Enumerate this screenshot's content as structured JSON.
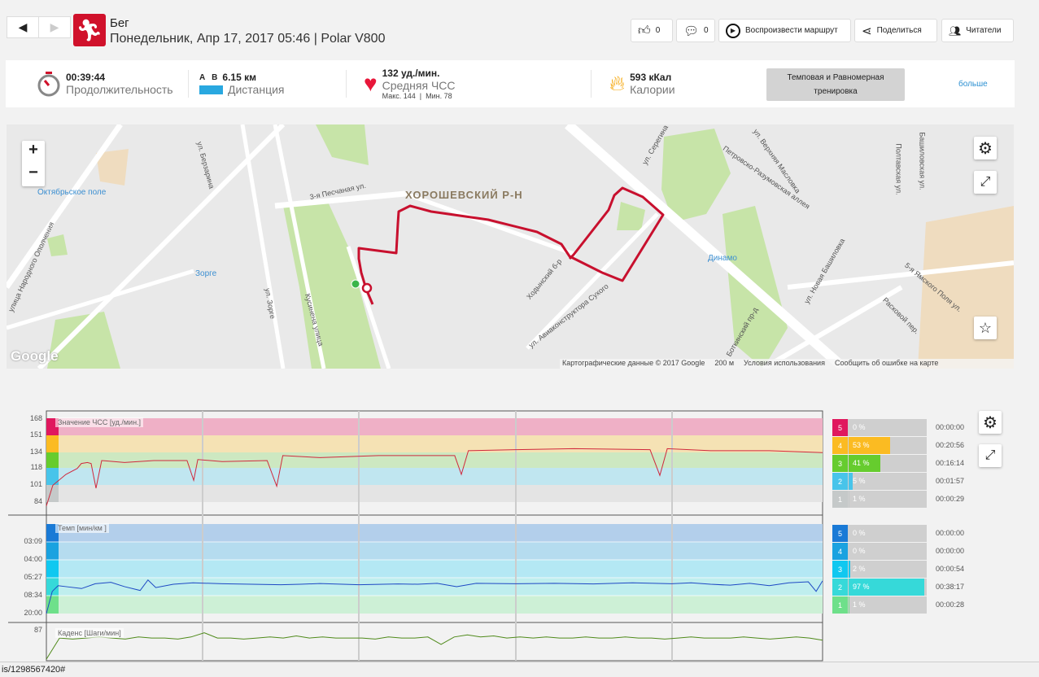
{
  "header": {
    "activity": "Бег",
    "subtitle": "Понедельник, Апр 17, 2017 05:46 | Polar V800",
    "likes": "0",
    "comments": "0",
    "play_route": "Воспроизвести маршрут",
    "share": "Поделиться",
    "readers": "Читатели"
  },
  "summary": {
    "duration_value": "00:39:44",
    "duration_label": "Продолжительность",
    "distance_ab": "A   B",
    "distance_value": "6.15 км",
    "distance_label": "Дистанция",
    "hr_value": "132 уд./мин.",
    "hr_label": "Средняя ЧСС",
    "hr_max": "Макс. 144",
    "hr_min": "Мин. 78",
    "calories_value": "593 кКал",
    "calories_label": "Калории",
    "training_type": "Темповая и Равномерная тренировка",
    "more": "больше"
  },
  "map": {
    "labels": {
      "district": "ХОРОШЕВСКИЙ Р-Н",
      "metro1": "Октябрьское поле",
      "metro2": "Зорге",
      "metro3": "Динамо",
      "street1": "3-я Песчаная ул.",
      "street2": "ул. Берзарина",
      "street3": "ул. Зорге",
      "street4": "улица Народного Ополчения",
      "street5": "Кусинена улица",
      "street6": "ул. Авиаконструктора Сухого",
      "street7": "Ходынский б-р",
      "street8": "Петровско-Разумовская аллея",
      "street9": "ул. Новая Башиловка",
      "street10": "ул. Верхняя Масловка",
      "street11": "5-я Ямского Поля ул.",
      "street12": "Боткинский пр-д",
      "street13": "Расковой пер.",
      "street14": "Полтавская ул.",
      "street15": "Башиловская ул.",
      "street16": "ул. Серегина"
    },
    "attribution": "Картографические данные © 2017 Google",
    "scale": "200 м",
    "terms": "Условия использования",
    "report": "Сообщить об ошибке на карте",
    "logo": "Google",
    "route_color": "#c8102e"
  },
  "charts": {
    "hr": {
      "title": "Значение ЧСС [уд./мин.]",
      "ticks": [
        "168",
        "151",
        "134",
        "118",
        "101",
        "84"
      ],
      "zones": [
        {
          "n": "5",
          "pct": "0 %",
          "frac": 0,
          "time": "00:00:00",
          "color": "#e0185e",
          "band": "#efb0c6"
        },
        {
          "n": "4",
          "pct": "53 %",
          "frac": 0.53,
          "time": "00:20:56",
          "color": "#fbbb22",
          "band": "#f5e2b4"
        },
        {
          "n": "3",
          "pct": "41 %",
          "frac": 0.41,
          "time": "00:16:14",
          "color": "#66cc2e",
          "band": "#cde8c1"
        },
        {
          "n": "2",
          "pct": "5 %",
          "frac": 0.05,
          "time": "00:01:57",
          "color": "#48c4ea",
          "band": "#c0e6f0"
        },
        {
          "n": "1",
          "pct": "1 %",
          "frac": 0.01,
          "time": "00:00:29",
          "color": "#c5c9c9",
          "band": "#e4e4e4"
        }
      ]
    },
    "pace": {
      "title": "Темп [мин/км ]",
      "ticks": [
        "03:09",
        "04:00",
        "05:27",
        "08:34",
        "20:00"
      ],
      "zones": [
        {
          "n": "5",
          "pct": "0 %",
          "frac": 0,
          "time": "00:00:00",
          "color": "#1a7ad6",
          "band": "#b3cfeb"
        },
        {
          "n": "4",
          "pct": "0 %",
          "frac": 0,
          "time": "00:00:00",
          "color": "#1aa2e0",
          "band": "#b5dcef"
        },
        {
          "n": "3",
          "pct": "2 %",
          "frac": 0.02,
          "time": "00:00:54",
          "color": "#10c8f0",
          "band": "#b4e8f4"
        },
        {
          "n": "2",
          "pct": "97 %",
          "frac": 0.97,
          "time": "00:38:17",
          "color": "#36d9d9",
          "band": "#bfeeee"
        },
        {
          "n": "1",
          "pct": "1 %",
          "frac": 0.01,
          "time": "00:00:28",
          "color": "#6ee08a",
          "band": "#cdf0d6"
        }
      ]
    },
    "cadence": {
      "title": "Каденс [Шаги/мин]",
      "ticks": [
        "87"
      ]
    }
  },
  "chart_data": [
    {
      "type": "line",
      "title": "Значение ЧСС [уд./мин.]",
      "ylim": [
        84,
        168
      ],
      "x_max": 39.73,
      "points": [
        [
          0,
          80
        ],
        [
          0.33,
          101
        ],
        [
          1,
          112
        ],
        [
          1.58,
          118
        ],
        [
          1.79,
          123
        ],
        [
          2.1,
          124
        ],
        [
          2.29,
          123
        ],
        [
          2.54,
          98
        ],
        [
          2.83,
          126
        ],
        [
          4,
          124
        ],
        [
          5.5,
          126
        ],
        [
          7.2,
          126
        ],
        [
          7.54,
          106
        ],
        [
          7.75,
          127
        ],
        [
          9,
          125
        ],
        [
          11.3,
          126
        ],
        [
          11.79,
          100
        ],
        [
          12.1,
          131
        ],
        [
          14,
          129
        ],
        [
          17,
          131
        ],
        [
          20.9,
          131
        ],
        [
          21.24,
          112
        ],
        [
          21.6,
          136
        ],
        [
          24,
          137
        ],
        [
          27,
          138
        ],
        [
          30.9,
          137
        ],
        [
          31.4,
          111
        ],
        [
          31.78,
          138
        ],
        [
          34,
          136
        ],
        [
          37,
          136
        ],
        [
          39.73,
          134
        ]
      ]
    },
    {
      "type": "line",
      "title": "Темп [мин/км ]",
      "ylim_labels": [
        "03:09",
        "04:00",
        "05:27",
        "08:34",
        "20:00"
      ],
      "x_max": 39.73,
      "points_sec_per_km": [
        [
          0,
          1200
        ],
        [
          0.3,
          470
        ],
        [
          0.6,
          410
        ],
        [
          1,
          420
        ],
        [
          1.8,
          440
        ],
        [
          2.5,
          390
        ],
        [
          3.3,
          375
        ],
        [
          4,
          420
        ],
        [
          4.8,
          460
        ],
        [
          5.2,
          350
        ],
        [
          5.6,
          430
        ],
        [
          6.5,
          395
        ],
        [
          7.5,
          380
        ],
        [
          9,
          390
        ],
        [
          12,
          400
        ],
        [
          13,
          395
        ],
        [
          14,
          388
        ],
        [
          16,
          400
        ],
        [
          18,
          392
        ],
        [
          19,
          395
        ],
        [
          20,
          385
        ],
        [
          21,
          420
        ],
        [
          22,
          385
        ],
        [
          24,
          390
        ],
        [
          26,
          385
        ],
        [
          28,
          392
        ],
        [
          30,
          380
        ],
        [
          32,
          390
        ],
        [
          33,
          380
        ],
        [
          34,
          395
        ],
        [
          35,
          405
        ],
        [
          36,
          385
        ],
        [
          37,
          410
        ],
        [
          38,
          380
        ],
        [
          39,
          370
        ],
        [
          39.4,
          470
        ],
        [
          39.73,
          360
        ]
      ]
    },
    {
      "type": "line",
      "title": "Каденс [Шаги/мин]",
      "ylim": [
        60,
        87
      ],
      "x_max": 39.73,
      "values": [
        60,
        80,
        79,
        80,
        81,
        80,
        79,
        81,
        80,
        80,
        79,
        81,
        85,
        80,
        80,
        79,
        80,
        81,
        80,
        82,
        80,
        81,
        80,
        80,
        80,
        79,
        81,
        80,
        80,
        81,
        74,
        81,
        83,
        81,
        82,
        80,
        81,
        80,
        81,
        80,
        80,
        81,
        80,
        80,
        81,
        80,
        80,
        79,
        80,
        81,
        80,
        80,
        80,
        81,
        80,
        79,
        80,
        81,
        80,
        78
      ]
    }
  ],
  "statusbar": {
    "url": "is/1298567420#"
  }
}
